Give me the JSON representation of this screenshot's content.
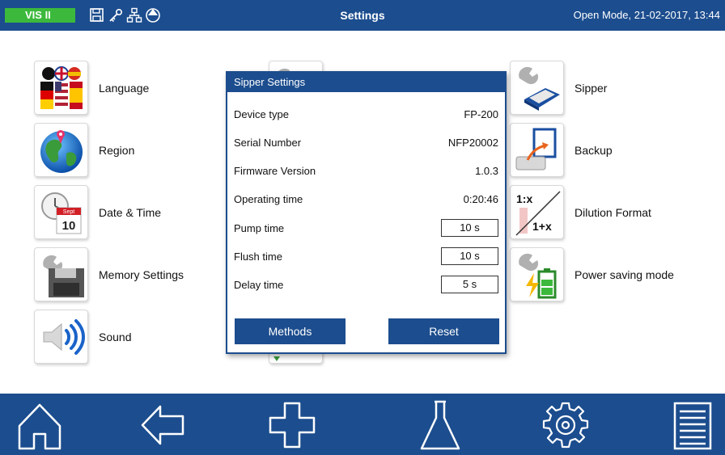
{
  "topbar": {
    "brand": "VIS II",
    "title": "Settings",
    "status": "Open Mode, 21-02-2017, 13:44",
    "icons": [
      "save-icon",
      "key-icon",
      "network-icon",
      "sync-icon"
    ],
    "colors": {
      "bar": "#1c4d8e",
      "brand": "#3cb93c"
    }
  },
  "tiles": {
    "language": "Language",
    "region": "Region",
    "datetime": "Date & Time",
    "memory": "Memory Settings",
    "sound": "Sound",
    "sipper": "Sipper",
    "backup": "Backup",
    "dilution": "Dilution Format",
    "power": "Power saving mode",
    "calendar_month": "Sept",
    "calendar_day": "10",
    "dilution_top": "1:x",
    "dilution_bottom": "1+x"
  },
  "dialog": {
    "title": "Sipper Settings",
    "device_type_label": "Device type",
    "device_type_value": "FP-200",
    "serial_label": "Serial Number",
    "serial_value": "NFP20002",
    "firmware_label": "Firmware Version",
    "firmware_value": "1.0.3",
    "operating_label": "Operating time",
    "operating_value": "0:20:46",
    "pump_label": "Pump time",
    "pump_value": "10 s",
    "flush_label": "Flush time",
    "flush_value": "10 s",
    "delay_label": "Delay time",
    "delay_value": "5 s",
    "methods_button": "Methods",
    "reset_button": "Reset"
  },
  "bottombar": {
    "icons": [
      "home-icon",
      "back-icon",
      "add-icon",
      "flask-icon",
      "settings-gear-icon",
      "list-icon"
    ]
  }
}
